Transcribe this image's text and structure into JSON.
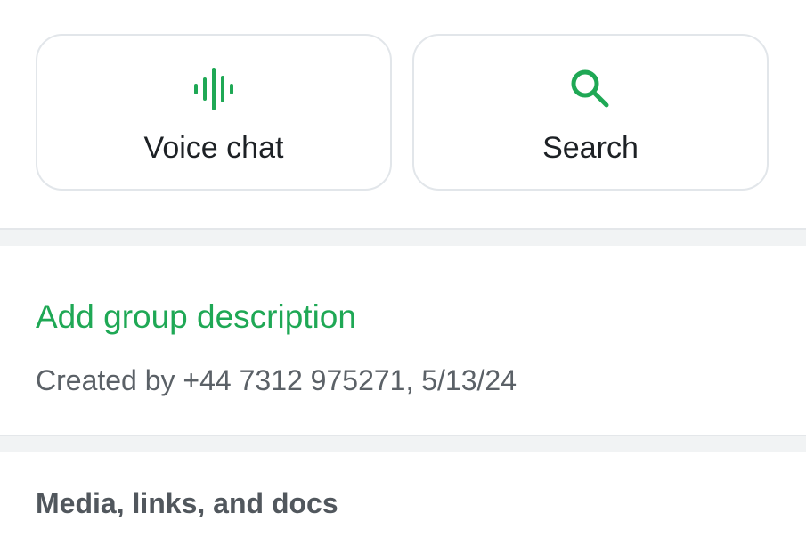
{
  "actions": [
    {
      "label": "Voice chat",
      "icon": "voice-chat-icon"
    },
    {
      "label": "Search",
      "icon": "search-icon"
    }
  ],
  "group": {
    "add_description": "Add group description",
    "created_by": "Created by +44 7312 975271, 5/13/24"
  },
  "media": {
    "title": "Media, links, and docs"
  },
  "colors": {
    "accent": "#1fa855",
    "card_border": "#e2e6ea",
    "separator": "#f1f3f4",
    "secondary_text": "#5b6167"
  }
}
